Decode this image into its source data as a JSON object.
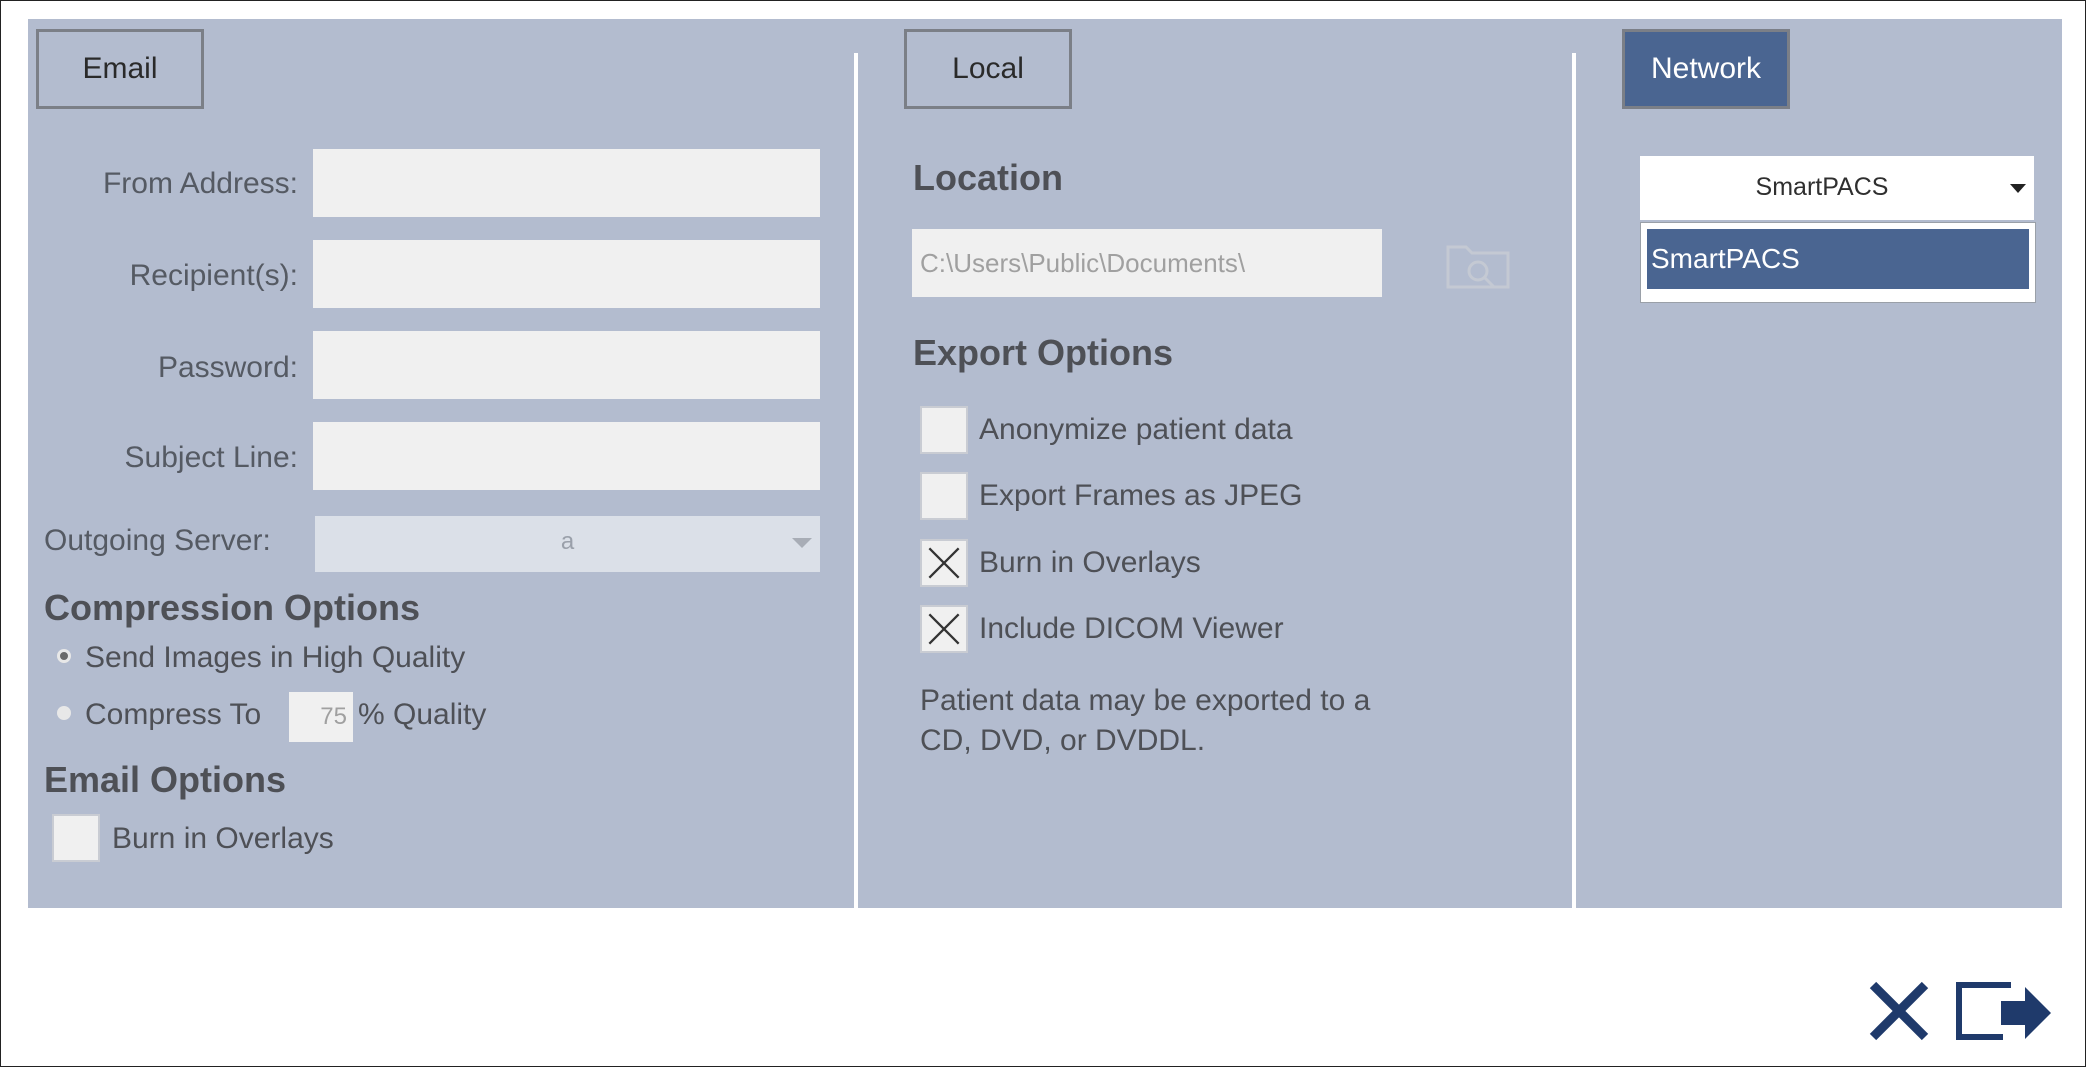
{
  "tabs": {
    "email": "Email",
    "local": "Local",
    "network": "Network"
  },
  "email": {
    "from_label": "From Address:",
    "from_value": "",
    "recipients_label": "Recipient(s):",
    "recipients_value": "",
    "password_label": "Password:",
    "password_value": "",
    "subject_label": "Subject Line:",
    "subject_value": "",
    "server_label": "Outgoing Server:",
    "server_value": "a"
  },
  "compression": {
    "heading": "Compression Options",
    "high_quality": "Send Images in High Quality",
    "compress_to": "Compress To",
    "quality_value": "75",
    "quality_suffix": "% Quality",
    "selected": "high_quality"
  },
  "email_options": {
    "heading": "Email Options",
    "burn_overlays": "Burn in Overlays",
    "burn_overlays_checked": false
  },
  "local": {
    "location_heading": "Location",
    "path": "C:\\Users\\Public\\Documents\\",
    "export_heading": "Export Options",
    "options": [
      {
        "label": "Anonymize patient data",
        "checked": false
      },
      {
        "label": "Export Frames as JPEG",
        "checked": false
      },
      {
        "label": "Burn in Overlays",
        "checked": true
      },
      {
        "label": "Include DICOM Viewer",
        "checked": true
      }
    ],
    "note_line1": "Patient data may be exported to a",
    "note_line2": "CD, DVD, or DVDDL."
  },
  "network": {
    "selected_server": "SmartPACS",
    "list": [
      "SmartPACS"
    ]
  },
  "colors": {
    "panel": "#b3bccf",
    "accent": "#4a6591",
    "action": "#1f3a6b"
  }
}
